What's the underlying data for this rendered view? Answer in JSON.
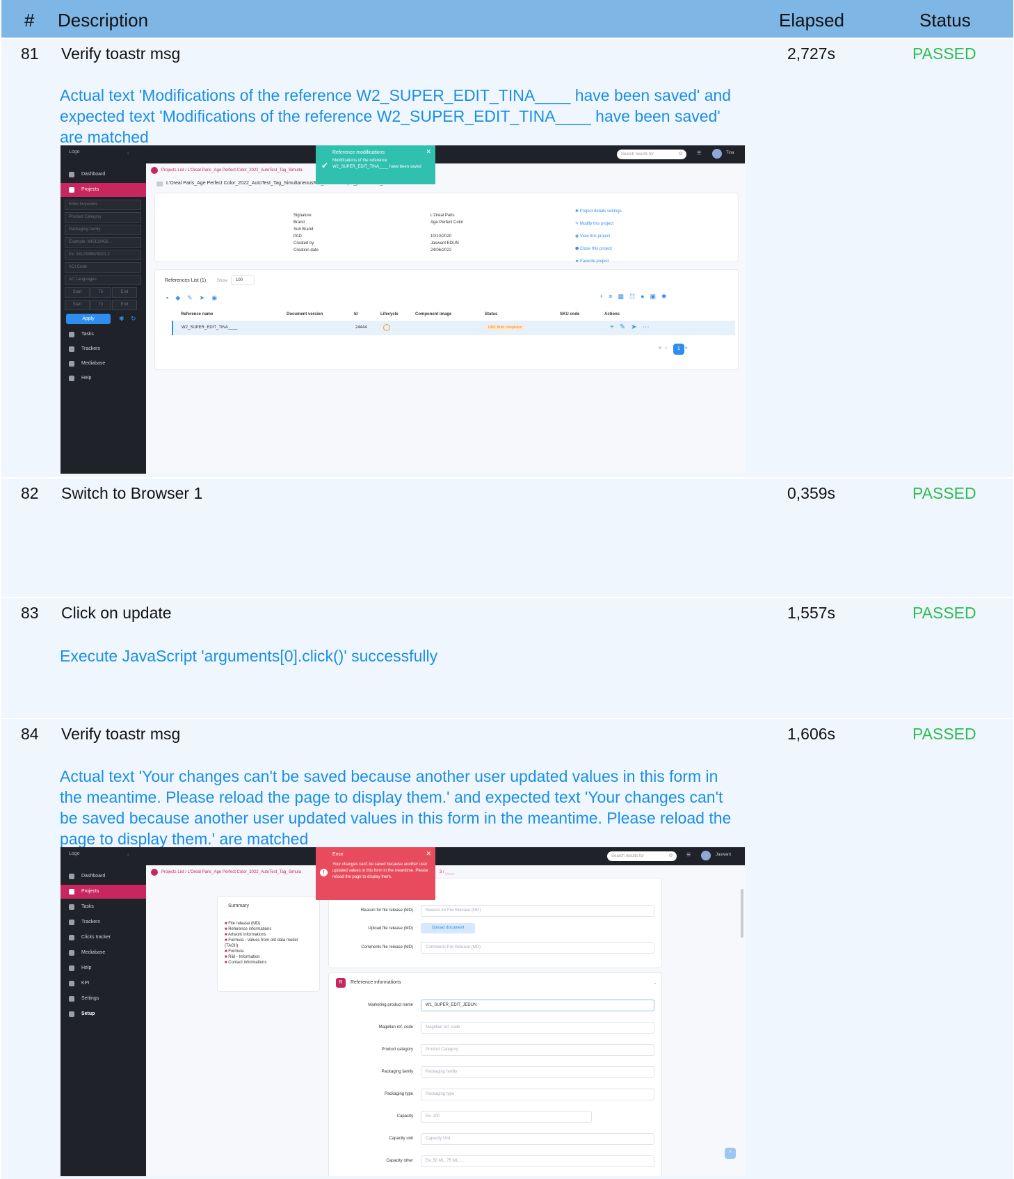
{
  "header": {
    "num": "#",
    "desc": "Description",
    "elapsed": "Elapsed",
    "status": "Status"
  },
  "rows": [
    {
      "num": "81",
      "desc": "Verify toastr msg",
      "elapsed": "2,727s",
      "status": "PASSED",
      "message": "Actual text 'Modifications of the reference W2_SUPER_EDIT_TINA____ have been saved' and expected text 'Modifications of the reference W2_SUPER_EDIT_TINA____ have been saved' are matched"
    },
    {
      "num": "82",
      "desc": "Switch to Browser 1",
      "elapsed": "0,359s",
      "status": "PASSED",
      "message": ""
    },
    {
      "num": "83",
      "desc": "Click on update",
      "elapsed": "1,557s",
      "status": "PASSED",
      "message": "Execute JavaScript 'arguments[0].click()' successfully"
    },
    {
      "num": "84",
      "desc": "Verify toastr msg",
      "elapsed": "1,606s",
      "status": "PASSED",
      "message": "Actual text 'Your changes can't be saved because another user updated values in this form in the meantime. Please reload the page to display them.' and expected text 'Your changes can't be saved because another user updated values in this form in the meantime. Please reload the page to display them.' are matched"
    }
  ],
  "shot1": {
    "logo": "Logo",
    "search": "Search results for",
    "user": "Tina",
    "toast_title": "Reference modifications",
    "toast_body": "Modifications of the reference W2_SUPER_EDIT_TINA____ have been saved",
    "breadcrumb": "Projects List / L'Oreal Paris_Age Perfect Color_2022_AutoTest_Tag_Simulta",
    "project_title": "L'Oreal Paris_Age Perfect Color_2022_AutoTest_Tag_SimultaneousRef_OHrDa3Y9pH_juin242022_110353 - MI003413",
    "sidebar": [
      "Dashboard",
      "Projects",
      "Tasks",
      "Trackers",
      "Mediabase",
      "Help"
    ],
    "filters": [
      "Enter keywords",
      "Product Category",
      "Packaging family",
      "Example: MI0123456...",
      "Ex: 3312345678901 2",
      "ACI Code",
      "AC Languages"
    ],
    "date_start": "Start",
    "date_to": "To",
    "date_end": "End",
    "apply": "Apply",
    "details_labels": [
      "Signature",
      "Brand",
      "Sub Brand",
      "PAD",
      "Created by",
      "Creation date"
    ],
    "details_values": [
      "L'Oreal Paris",
      "Age Perfect Color",
      "",
      "10/10/2020",
      "Jaswant EDUN",
      "24/06/2022"
    ],
    "actions": [
      "Project details settings",
      "Modify this project",
      "View this project",
      "Close this project",
      "Favorite project"
    ],
    "ref_list": "References List (1)",
    "show": "Show",
    "show_val": "100",
    "cols": [
      "Reference name",
      "Document version",
      "Id",
      "Lifecycle",
      "Component image",
      "Status",
      "SKU code",
      "Actions"
    ],
    "ref_name": "W2_SUPER_EDIT_TINA____",
    "ref_id": "24444",
    "ref_status": "DMC Brief completion",
    "page": "1"
  },
  "shot2": {
    "logo": "Logo",
    "search": "Search results for",
    "user": "Jaswant",
    "toast_title": "Error",
    "toast_body": "Your changes can't be saved because another user updated values in this form in the meantime. Please reload the page to display them.",
    "breadcrumb": "Projects List / L'Oreal Paris_Age Perfect Color_2022_AutoTest_Tag_Simula",
    "bc_tail": "3 / ____",
    "sidebar": [
      "Dashboard",
      "Projects",
      "Tasks",
      "Trackers",
      "Clicks tracker",
      "Mediabase",
      "Help",
      "KPI",
      "Settings",
      "Setup"
    ],
    "summary_title": "Summary",
    "summary": [
      "File release (MD)",
      "Reference informations",
      "Artwork informations",
      "Formula - Values from old data model (TAGII)",
      "Formula",
      "R&I - Information",
      "Contact informations"
    ],
    "f_reason_lbl": "Reason for file release (MD)",
    "f_reason_ph": "Reason for File Release (MD)",
    "f_upload_lbl": "Upload file release (MD)",
    "f_upload_btn": "Upload document",
    "f_comments_lbl": "Comments file release (MD)",
    "f_comments_ph": "Comments File Release (MD)",
    "section_badge": "R",
    "section_title": "Reference informations",
    "fields": [
      {
        "label": "Marketing product name",
        "value": "W1_SUPER_EDIT_JEDUN"
      },
      {
        "label": "Magellan ref. code",
        "value": "Magellan ref. code"
      },
      {
        "label": "Product category",
        "value": "Product Category"
      },
      {
        "label": "Packaging family",
        "value": "Packaging family"
      },
      {
        "label": "Packaging type",
        "value": "Packaging type"
      },
      {
        "label": "Capacity",
        "value": "Ex: 100"
      },
      {
        "label": "Capacity unit",
        "value": "Capacity Unit"
      },
      {
        "label": "Capacity other",
        "value": "Ex: 50 ML, 75 ML, ..."
      }
    ]
  }
}
